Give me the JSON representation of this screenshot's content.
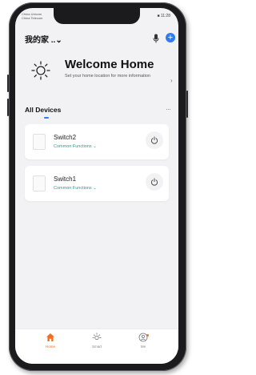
{
  "status_bar": {
    "carrier_line1": "China Unicom",
    "carrier_line2": "China Telecom",
    "right_text": "■ 11:28"
  },
  "header": {
    "home_name": "我的家 ..⌄",
    "mic_icon": "microphone-icon",
    "add_icon": "plus-icon",
    "add_symbol": "+"
  },
  "welcome": {
    "title": "Welcome Home",
    "subtitle": "Set your home location for more information",
    "chevron": "›",
    "icon": "sun-icon"
  },
  "devices_section": {
    "tab_label": "All Devices",
    "more": "···"
  },
  "devices": [
    {
      "name": "Switch2",
      "functions_label": "Common Functions ⌄",
      "power_icon": "power-icon"
    },
    {
      "name": "Switch1",
      "functions_label": "Common Functions ⌄",
      "power_icon": "power-icon"
    }
  ],
  "tabbar": {
    "items": [
      {
        "label": "Home",
        "icon": "house-icon",
        "active": true
      },
      {
        "label": "Smart",
        "icon": "sun-icon",
        "active": false
      },
      {
        "label": "Me",
        "icon": "profile-icon",
        "active": false
      }
    ]
  },
  "colors": {
    "accent_blue": "#2f7bf6",
    "accent_orange": "#f26f21",
    "function_teal": "#2f9c8f",
    "screen_bg": "#f2f2f5"
  }
}
